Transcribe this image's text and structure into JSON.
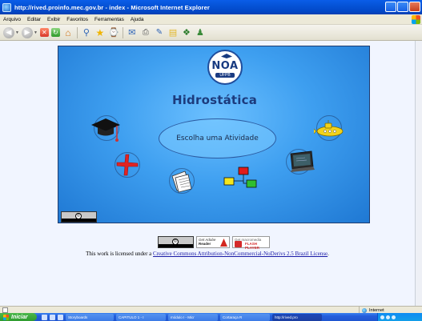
{
  "window": {
    "title": "http://rived.proinfo.mec.gov.br - index - Microsoft Internet Explorer"
  },
  "menu": [
    "Arquivo",
    "Editar",
    "Exibir",
    "Favoritos",
    "Ferramentas",
    "Ajuda"
  ],
  "flash": {
    "logo_text": "NOA",
    "logo_sub": "UFPB",
    "title": "Hidrostática",
    "prompt": "Escolha uma Atividade"
  },
  "badges": {
    "reader_get": "Get Adobe",
    "reader_prod": "Reader",
    "flash_get": "Get macromedia",
    "flash_prod": "FLASH PLAYER"
  },
  "license": {
    "prefix": "This work is licensed under a ",
    "link": "Creative Commons Attribution-NonCommercial-NoDerivs 2.5 Brazil License",
    "suffix": "."
  },
  "statusbar": {
    "zone": "Internet"
  },
  "taskbar": {
    "start": "Iniciar",
    "tasks": [
      "Storyboards",
      "CAPITULO 1 - I",
      "módulo I - Micr",
      "Cortaraça R",
      "http://rived.pro"
    ]
  }
}
